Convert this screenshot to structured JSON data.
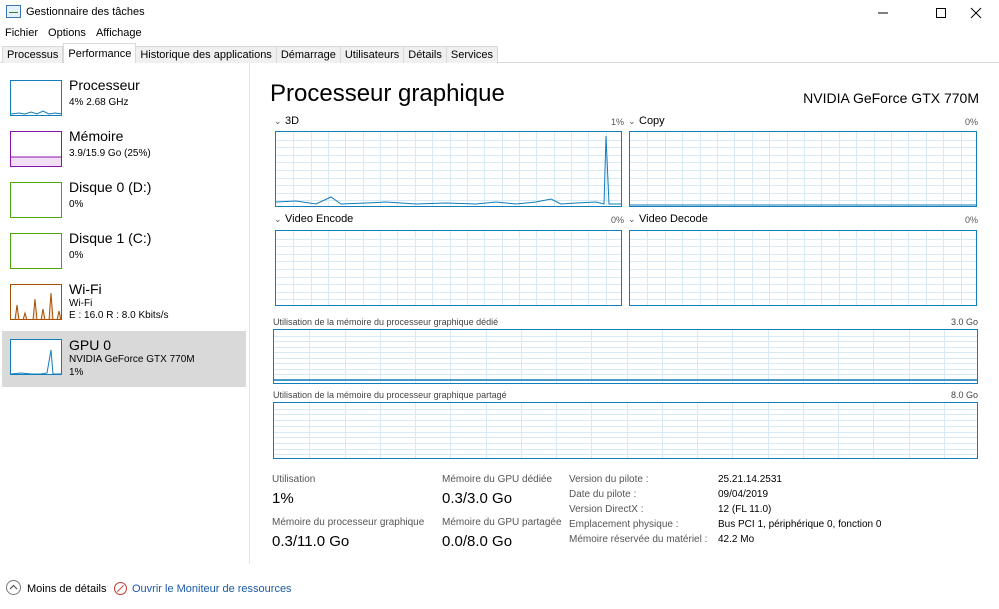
{
  "window": {
    "title": "Gestionnaire des tâches"
  },
  "menu": [
    "Fichier",
    "Options",
    "Affichage"
  ],
  "tabs": [
    {
      "label": "Processus",
      "active": false
    },
    {
      "label": "Performance",
      "active": true
    },
    {
      "label": "Historique des applications",
      "active": false
    },
    {
      "label": "Démarrage",
      "active": false
    },
    {
      "label": "Utilisateurs",
      "active": false
    },
    {
      "label": "Détails",
      "active": false
    },
    {
      "label": "Services",
      "active": false
    }
  ],
  "sidebar": {
    "items": [
      {
        "title": "Processeur",
        "line1": "4% 2.68 GHz",
        "color": "#117dbb"
      },
      {
        "title": "Mémoire",
        "line1": "3.9/15.9 Go (25%)",
        "color": "#8b12ae"
      },
      {
        "title": "Disque 0 (D:)",
        "line1": "0%",
        "color": "#4da60c"
      },
      {
        "title": "Disque 1 (C:)",
        "line1": "0%",
        "color": "#4da60c"
      },
      {
        "title": "Wi-Fi",
        "line1": "Wi-Fi",
        "line2": "E : 16.0 R : 8.0 Kbits/s",
        "color": "#a74f01"
      },
      {
        "title": "GPU 0",
        "line1": "NVIDIA GeForce GTX 770M",
        "line2": "1%",
        "color": "#117dbb"
      }
    ]
  },
  "main": {
    "heading": "Processeur graphique",
    "model": "NVIDIA GeForce GTX 770M",
    "graphs": [
      {
        "label": "3D",
        "pct": "1%"
      },
      {
        "label": "Copy",
        "pct": "0%"
      },
      {
        "label": "Video Encode",
        "pct": "0%"
      },
      {
        "label": "Video Decode",
        "pct": "0%"
      }
    ],
    "dedicated": {
      "label": "Utilisation de la mémoire du processeur graphique dédié",
      "max": "3.0 Go"
    },
    "shared": {
      "label": "Utilisation de la mémoire du processeur graphique partagé",
      "max": "8.0 Go"
    }
  },
  "stats": {
    "utilisation_label": "Utilisation",
    "utilisation_value": "1%",
    "dedicated_label": "Mémoire du GPU dédiée",
    "dedicated_value": "0.3/3.0 Go",
    "gpu_mem_label": "Mémoire du processeur graphique",
    "gpu_mem_value": "0.3/11.0 Go",
    "shared_label": "Mémoire du GPU partagée",
    "shared_value": "0.0/8.0 Go"
  },
  "info": [
    {
      "label": "Version du pilote :",
      "value": "25.21.14.2531"
    },
    {
      "label": "Date du pilote :",
      "value": "09/04/2019"
    },
    {
      "label": "Version DirectX :",
      "value": "12 (FL 11.0)"
    },
    {
      "label": "Emplacement physique :",
      "value": "Bus PCI 1, périphérique 0, fonction 0"
    },
    {
      "label": "Mémoire réservée du matériel :",
      "value": "42.2 Mo"
    }
  ],
  "footer": {
    "less_details": "Moins de détails",
    "resource_monitor": "Ouvrir le Moniteur de ressources"
  },
  "colors": {
    "gpu_line": "#117dbb",
    "grid": "#d9eaf7"
  }
}
